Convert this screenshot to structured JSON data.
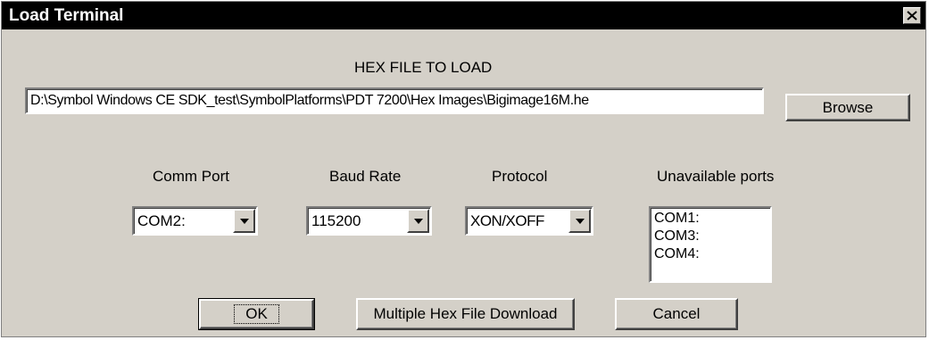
{
  "window": {
    "title": "Load Terminal",
    "close_glyph": "×"
  },
  "hex_section": {
    "heading": "HEX FILE TO LOAD",
    "path_value": "D:\\Symbol Windows CE SDK_test\\SymbolPlatforms\\PDT 7200\\Hex Images\\Bigimage16M.he",
    "browse_label": "Browse"
  },
  "settings": {
    "comm_port": {
      "label": "Comm Port",
      "value": "COM2:"
    },
    "baud_rate": {
      "label": "Baud Rate",
      "value": "115200"
    },
    "protocol": {
      "label": "Protocol",
      "value": "XON/XOFF"
    },
    "unavailable": {
      "label": "Unavailable ports",
      "items": [
        "COM1:",
        "COM3:",
        "COM4:"
      ]
    }
  },
  "buttons": {
    "ok": "OK",
    "multi": "Multiple Hex File Download",
    "cancel": "Cancel"
  },
  "icons": {
    "dropdown": "chevron-down-icon",
    "close": "close-icon"
  }
}
